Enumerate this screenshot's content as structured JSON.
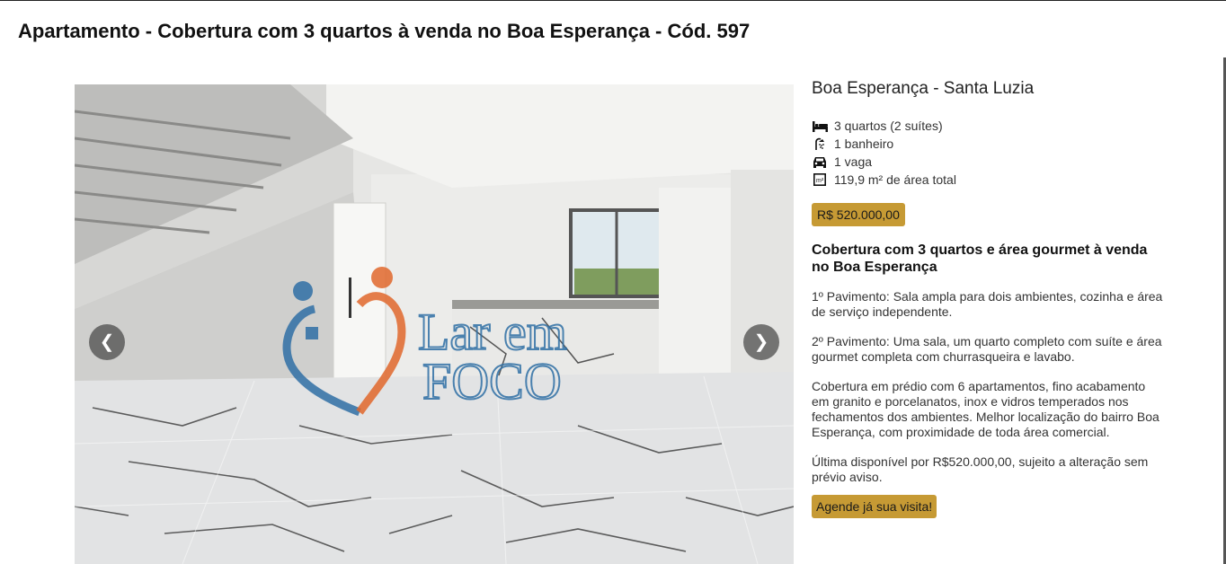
{
  "page": {
    "title": "Apartamento - Cobertura com 3 quartos à venda no Boa Esperança - Cód. 597"
  },
  "gallery": {
    "prev_label": "❮",
    "next_label": "❯",
    "watermark_text_1": "Lar em",
    "watermark_text_2": "FOCO"
  },
  "listing": {
    "location": "Boa Esperança - Santa Luzia",
    "features": [
      {
        "icon": "bed-icon",
        "text": "3 quartos (2 suítes)"
      },
      {
        "icon": "shower-icon",
        "text": "1 banheiro"
      },
      {
        "icon": "car-icon",
        "text": "1 vaga"
      },
      {
        "icon": "area-icon",
        "text": "119,9 m² de área total"
      }
    ],
    "price": "R$ 520.000,00",
    "description_title": "Cobertura com 3 quartos e área gourmet à venda no Boa Esperança",
    "paragraphs": [
      "1º Pavimento: Sala ampla para dois ambientes, cozinha e área de serviço independente.",
      "2º Pavimento: Uma sala, um quarto completo com suíte e área gourmet completa com churrasqueira e lavabo.",
      "Cobertura em prédio com 6 apartamentos, fino acabamento em granito e porcelanatos, inox e vidros temperados nos fechamentos dos ambientes. Melhor localização do bairro Boa Esperança, com proximidade de toda área comercial.",
      "Última disponível por R$520.000,00, sujeito a alteração sem prévio aviso."
    ],
    "cta_label": "Agende já sua visita!"
  },
  "colors": {
    "accent": "#c69a34",
    "watermark_blue": "#2f6fa5",
    "watermark_orange": "#e0672c"
  }
}
